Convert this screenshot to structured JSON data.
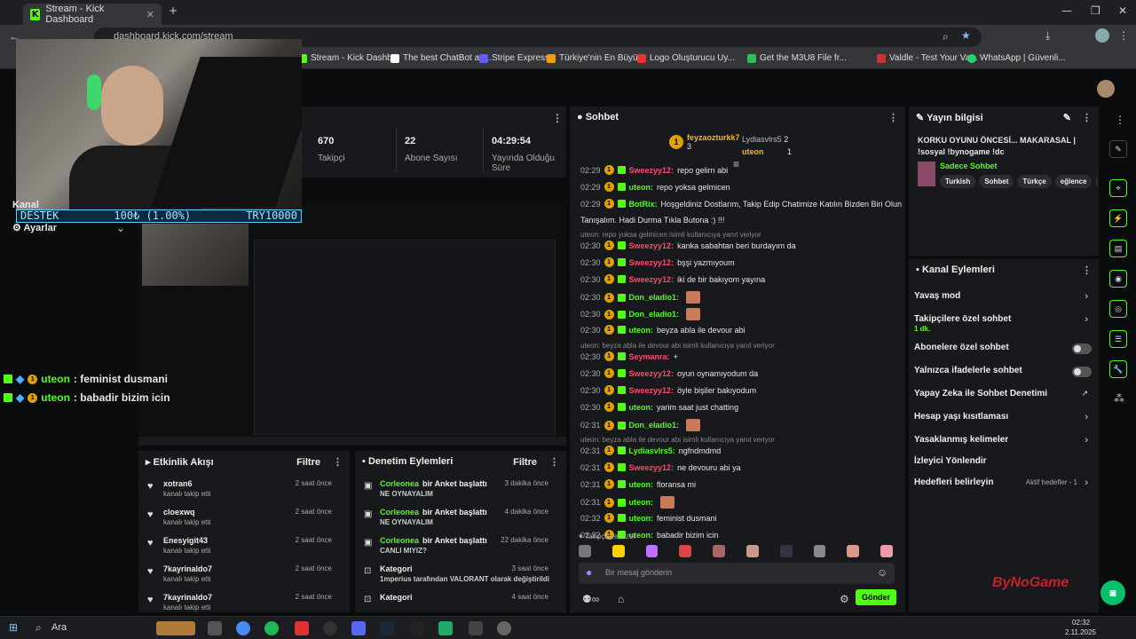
{
  "browser": {
    "tab_title": "Stream - Kick Dashboard",
    "url": "dashboard.kick.com/stream",
    "bookmarks": [
      "Stream - Kick Dashb...",
      "The best ChatBot an...",
      "Stripe Express",
      "Türkiye'nin En Büyü...",
      "Logo Oluşturucu Uy...",
      "Get the M3U8 File fr...",
      "Valdle - Test Your Va...",
      "WhatsApp | Güvenli..."
    ]
  },
  "stats": [
    {
      "value": "670",
      "label": "Takipçi"
    },
    {
      "value": "22",
      "label": "Abone Sayısı"
    },
    {
      "value": "04:29:54",
      "label": "Yayında Olduğu Süre"
    }
  ],
  "overlay": {
    "donation_label": "DESTEK",
    "donation_value": "100₺ (1.00%)",
    "donation_target": "TRY10000",
    "nav_kanal": "Kanal",
    "nav_ayarlar": "Ayarlar",
    "feed": [
      {
        "badge": "1",
        "user": "uteon",
        "text": ": feminist dusmani"
      },
      {
        "badge": "1",
        "user": "uteon",
        "text": ": babadir bizim icin"
      }
    ]
  },
  "chat": {
    "title": "Sohbet",
    "leaderboard": [
      {
        "rank": "1",
        "name": "feyzaozturkk7",
        "score": "3"
      },
      {
        "rank": "",
        "name": "Lydiasvlrs5",
        "score": "2"
      },
      {
        "rank": "",
        "name": "uteon",
        "score": "1"
      }
    ],
    "messages": [
      {
        "time": "02:29",
        "user": "Sweezyy12:",
        "color": "pink",
        "text": "repo gelirn abi",
        "reply": ""
      },
      {
        "time": "02:29",
        "user": "uteon:",
        "color": "green",
        "text": "repo yoksa gelmicen",
        "reply": ""
      },
      {
        "time": "02:29",
        "user": "BotRix:",
        "color": "green",
        "text": "Hoşgeldiniz Dostlarım, Takip Edip Chatimize Katılın Bizden Biri Olun",
        "reply": ""
      },
      {
        "time": "",
        "user": "",
        "color": "",
        "text": "Tanışalım. Hadi Durma Tıkla Butona :) !!!",
        "reply": ""
      },
      {
        "time": "",
        "user": "",
        "color": "",
        "text": "",
        "reply": "uteon: repo yoksa gelmicen isimli kullanıcıya yanıt veriyor"
      },
      {
        "time": "02:30",
        "user": "Sweezyy12:",
        "color": "pink",
        "text": "kanka sabahtan beri burdayım da",
        "reply": ""
      },
      {
        "time": "02:30",
        "user": "Sweezyy12:",
        "color": "pink",
        "text": "bşşi yazmıyoum",
        "reply": ""
      },
      {
        "time": "02:30",
        "user": "Sweezyy12:",
        "color": "pink",
        "text": "iki de bir bakıyom yayına",
        "reply": ""
      },
      {
        "time": "02:30",
        "user": "Don_eladio1:",
        "color": "green",
        "text": "",
        "reply": ""
      },
      {
        "time": "02:30",
        "user": "Don_eladio1:",
        "color": "green",
        "text": "",
        "reply": ""
      },
      {
        "time": "02:30",
        "user": "uteon:",
        "color": "green",
        "text": "beyza abla ile devour abi",
        "reply": ""
      },
      {
        "time": "",
        "user": "",
        "color": "",
        "text": "",
        "reply": "uteon: beyza abla ile devour abi isimli kullanıcıya yanıt veriyor"
      },
      {
        "time": "02:30",
        "user": "Seymanra:",
        "color": "pink",
        "text": "+",
        "reply": ""
      },
      {
        "time": "02:30",
        "user": "Sweezyy12:",
        "color": "pink",
        "text": "oyun oynamıyodum da",
        "reply": ""
      },
      {
        "time": "02:30",
        "user": "Sweezyy12:",
        "color": "pink",
        "text": "öyle bişiler bakıyodum",
        "reply": ""
      },
      {
        "time": "02:30",
        "user": "uteon:",
        "color": "green",
        "text": "yarim saat just chatting",
        "reply": ""
      },
      {
        "time": "02:31",
        "user": "Don_eladio1:",
        "color": "green",
        "text": "",
        "reply": ""
      },
      {
        "time": "",
        "user": "",
        "color": "",
        "text": "",
        "reply": "uteon: beyza abla ile devour abi isimli kullanıcıya yanıt veriyor"
      },
      {
        "time": "02:31",
        "user": "Lydiasvlrs5:",
        "color": "green",
        "text": "ngfndmdmd",
        "reply": ""
      },
      {
        "time": "02:31",
        "user": "Sweezyy12:",
        "color": "pink",
        "text": "ne devouru abi ya",
        "reply": ""
      },
      {
        "time": "02:31",
        "user": "uteon:",
        "color": "green",
        "text": "floransa mi",
        "reply": ""
      },
      {
        "time": "02:31",
        "user": "uteon:",
        "color": "green",
        "text": "",
        "reply": ""
      },
      {
        "time": "02:32",
        "user": "uteon:",
        "color": "green",
        "text": "feminist dusmani",
        "reply": ""
      },
      {
        "time": "02:32",
        "user": "uteon:",
        "color": "green",
        "text": "babadir bizim icin",
        "reply": ""
      }
    ],
    "followers_special": "Takipçilere Özel",
    "input_placeholder": "Bir mesaj gönderin",
    "send_label": "Gönder"
  },
  "stream_info": {
    "title": "Yayın bilgisi",
    "stream_title": "KORKU OYUNU ÖNCESİ... MAKARASAL | !sosyal !bynogame !dc",
    "category": "Sadece Sohbet",
    "tags": [
      "Turkish",
      "Sohbet",
      "Türkçe",
      "eğlence",
      "fp"
    ]
  },
  "channel_actions": {
    "title": "Kanal Eylemleri",
    "items": [
      {
        "label": "Yavaş mod",
        "sub": "",
        "control": "chevron"
      },
      {
        "label": "Takipçilere özel sohbet",
        "sub": "1 dk.",
        "control": "chevron"
      },
      {
        "label": "Abonelere özel sohbet",
        "sub": "",
        "control": "toggle"
      },
      {
        "label": "Yalnızca ifadelerle sohbet",
        "sub": "",
        "control": "toggle"
      },
      {
        "label": "Yapay Zeka ile Sohbet Denetimi",
        "sub": "",
        "control": "external"
      },
      {
        "label": "Hesap yaşı kısıtlaması",
        "sub": "",
        "control": "chevron"
      },
      {
        "label": "Yasaklanmış kelimeler",
        "sub": "",
        "control": "chevron"
      },
      {
        "label": "İzleyici Yönlendir",
        "sub": "",
        "control": "none"
      },
      {
        "label": "Hedefleri belirleyin",
        "sub": "",
        "control": "chevron"
      }
    ],
    "goals_status": "Aktif hedefler - 1"
  },
  "activity": {
    "title": "Etkinlik Akışı",
    "filter": "Filtre",
    "items": [
      {
        "name": "xotran6",
        "sub": "kanalı takip etti",
        "time": "2 saat önce"
      },
      {
        "name": "cloexwq",
        "sub": "kanalı takip etti",
        "time": "2 saat önce"
      },
      {
        "name": "Enesyigit43",
        "sub": "kanalı takip etti",
        "time": "2 saat önce"
      },
      {
        "name": "7kayrinaldo7",
        "sub": "kanalı takip etti",
        "time": "2 saat önce"
      },
      {
        "name": "7kayrinaldo7",
        "sub": "kanalı takip etti",
        "time": "2 saat önce"
      }
    ]
  },
  "moderation": {
    "title": "Denetim Eylemleri",
    "filter": "Filtre",
    "items": [
      {
        "name": "Corleonea",
        "action": "bir Anket başlattı",
        "sub": "NE OYNAYALIM",
        "time": "3 dakika önce"
      },
      {
        "name": "Corleonea",
        "action": "bir Anket başlattı",
        "sub": "NE OYNAYALIM",
        "time": "4 dakika önce"
      },
      {
        "name": "Corleonea",
        "action": "bir Anket başlattı",
        "sub": "CANLI MIYIZ?",
        "time": "22 dakika önce"
      },
      {
        "name": "Kategori",
        "action": "",
        "sub": "1mperius tarafından VALORANT olarak değiştirildi",
        "time": "3 saat önce"
      },
      {
        "name": "Kategori",
        "action": "",
        "sub": "",
        "time": "4 saat önce"
      }
    ]
  },
  "watermark": "ByNoGame",
  "taskbar": {
    "search": "Ara",
    "time": "02:32",
    "date": "2.11.2025"
  }
}
